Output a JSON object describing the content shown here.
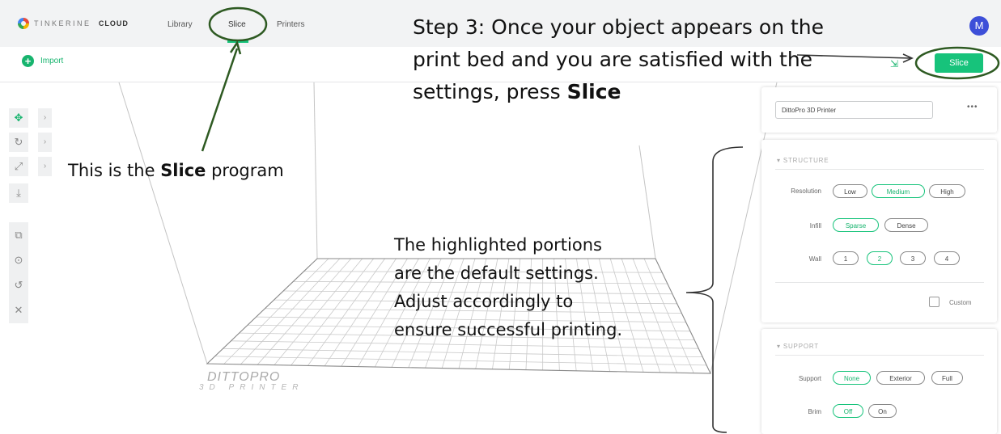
{
  "header": {
    "brand_light": "TINKERINE",
    "brand_bold": "CLOUD",
    "tabs": [
      {
        "label": "Library"
      },
      {
        "label": "Slice"
      },
      {
        "label": "Printers"
      }
    ],
    "avatar_initial": "M"
  },
  "toolbar": {
    "import_label": "Import",
    "slice_label": "Slice"
  },
  "left_tools": [
    "move-icon",
    "rotate-icon",
    "scale-icon",
    "download-icon",
    "duplicate-icon",
    "center-icon",
    "reset-icon",
    "delete-icon"
  ],
  "bed": {
    "brand": "DITTO",
    "brand_suffix": "PRO",
    "subtitle": "3D PRINTER"
  },
  "annotations": {
    "step3_prefix": "Step 3: Once your object appears on the print bed and you are satisfied with the settings, press ",
    "step3_bold": "Slice",
    "slice_prefix": "This is the ",
    "slice_bold": "Slice",
    "slice_suffix": " program",
    "defaults_line1": "The highlighted portions",
    "defaults_line2": "are the default settings.",
    "defaults_line3": "Adjust accordingly to",
    "defaults_line4": "ensure successful printing."
  },
  "panel": {
    "printer_value": "DittoPro 3D Printer",
    "more": "•••",
    "structure": {
      "title": "STRUCTURE",
      "resolution_label": "Resolution",
      "resolution_options": [
        "Low",
        "Medium",
        "High"
      ],
      "resolution_selected": "Medium",
      "infill_label": "Infill",
      "infill_options": [
        "Sparse",
        "Dense"
      ],
      "infill_selected": "Sparse",
      "wall_label": "Wall",
      "wall_options": [
        "1",
        "2",
        "3",
        "4"
      ],
      "wall_selected": "2",
      "custom_label": "Custom"
    },
    "support": {
      "title": "SUPPORT",
      "support_label": "Support",
      "support_options": [
        "None",
        "Exterior",
        "Full"
      ],
      "support_selected": "None",
      "brim_label": "Brim",
      "brim_options": [
        "Off",
        "On"
      ],
      "brim_selected": "Off"
    }
  },
  "colors": {
    "accent": "#17c37b",
    "annotation_stroke": "#2e5a22",
    "avatar": "#3d4fd8"
  }
}
